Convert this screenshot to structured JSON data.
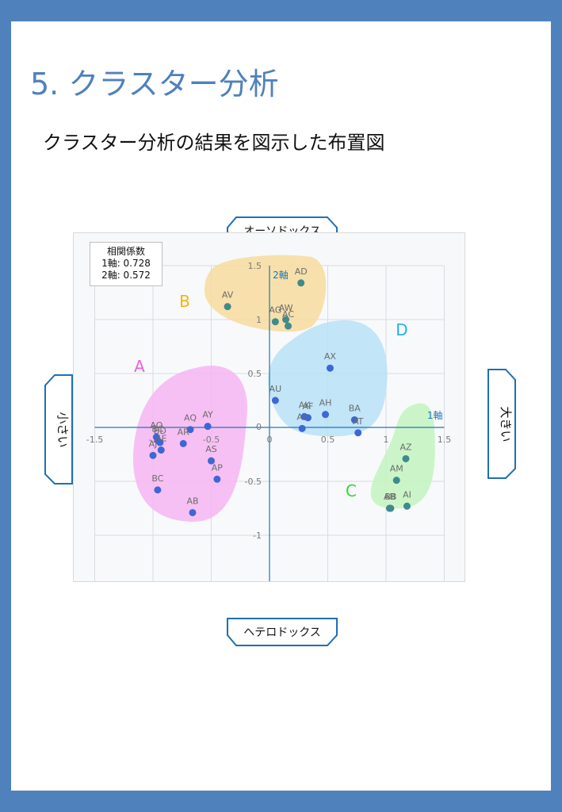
{
  "page": {
    "section_title": "5. クラスター分析",
    "subtitle": "クラスター分析の結果を図示した布置図"
  },
  "axis_end_labels": {
    "top": "オーソドックス",
    "bottom": "ヘテロドックス",
    "left": "小さい",
    "right": "大きい"
  },
  "correlation_box": {
    "title": "相関係数",
    "axis1": "1軸: 0.728",
    "axis2": "2軸: 0.572"
  },
  "colors": {
    "border": "#4f81bd",
    "axis": "#1f77b4",
    "cluster_A": "#f7b6f2",
    "cluster_B": "#f7dc9c",
    "cluster_C": "#c3f5c0",
    "cluster_D": "#b9e2f7",
    "label_A": "#f05ce0",
    "label_B": "#f5b400",
    "label_C": "#3ad43a",
    "label_D": "#1fb2ee",
    "point_blue": "#3e66d6",
    "point_teal": "#3f8a8c"
  },
  "chart_data": {
    "type": "scatter",
    "xlabel": "1軸",
    "ylabel": "2軸",
    "xlim": [
      -1.5,
      1.5
    ],
    "ylim": [
      -1.5,
      1.5
    ],
    "xticks": [
      -1.5,
      -1,
      -0.5,
      0,
      0.5,
      1,
      1.5
    ],
    "yticks": [
      -1.5,
      -1,
      -0.5,
      0,
      0.5,
      1,
      1.5
    ],
    "grid": true,
    "clusters": [
      {
        "name": "A",
        "color": "#f7b6f2",
        "label_color": "#f05ce0"
      },
      {
        "name": "B",
        "color": "#f7dc9c",
        "label_color": "#f5b400"
      },
      {
        "name": "C",
        "color": "#c3f5c0",
        "label_color": "#3ad43a"
      },
      {
        "name": "D",
        "color": "#b9e2f7",
        "label_color": "#1fb2ee"
      }
    ],
    "points": [
      {
        "label": "AD",
        "x": 0.27,
        "y": 1.34,
        "cluster": "B"
      },
      {
        "label": "AV",
        "x": -0.36,
        "y": 1.12,
        "cluster": "B"
      },
      {
        "label": "AG",
        "x": 0.05,
        "y": 0.98,
        "cluster": "B"
      },
      {
        "label": "AW",
        "x": 0.14,
        "y": 1.0,
        "cluster": "B"
      },
      {
        "label": "AC",
        "x": 0.16,
        "y": 0.94,
        "cluster": "B"
      },
      {
        "label": "AX",
        "x": 0.52,
        "y": 0.55,
        "cluster": "D"
      },
      {
        "label": "AU",
        "x": 0.05,
        "y": 0.25,
        "cluster": "D"
      },
      {
        "label": "AH",
        "x": 0.48,
        "y": 0.12,
        "cluster": "D"
      },
      {
        "label": "AK",
        "x": 0.3,
        "y": 0.1,
        "cluster": "D"
      },
      {
        "label": "AF",
        "x": 0.33,
        "y": 0.09,
        "cluster": "D"
      },
      {
        "label": "AL",
        "x": 0.28,
        "y": -0.01,
        "cluster": "D"
      },
      {
        "label": "BA",
        "x": 0.73,
        "y": 0.07,
        "cluster": "D"
      },
      {
        "label": "AT",
        "x": 0.76,
        "y": -0.05,
        "cluster": "D"
      },
      {
        "label": "AZ",
        "x": 1.17,
        "y": -0.29,
        "cluster": "C"
      },
      {
        "label": "AM",
        "x": 1.09,
        "y": -0.49,
        "cluster": "C"
      },
      {
        "label": "AB",
        "x": 1.03,
        "y": -0.75,
        "cluster": "C"
      },
      {
        "label": "BB",
        "x": 1.04,
        "y": -0.75,
        "cluster": "C"
      },
      {
        "label": "AI",
        "x": 1.18,
        "y": -0.73,
        "cluster": "C"
      },
      {
        "label": "AQ",
        "x": -0.68,
        "y": -0.02,
        "cluster": "A"
      },
      {
        "label": "AY",
        "x": -0.53,
        "y": 0.01,
        "cluster": "A"
      },
      {
        "label": "AO",
        "x": -0.97,
        "y": -0.09,
        "cluster": "A"
      },
      {
        "label": "BC",
        "x": -0.96,
        "y": -0.12,
        "cluster": "A"
      },
      {
        "label": "BD",
        "x": -0.94,
        "y": -0.14,
        "cluster": "A"
      },
      {
        "label": "AE",
        "x": -0.93,
        "y": -0.21,
        "cluster": "A"
      },
      {
        "label": "AJ",
        "x": -1.0,
        "y": -0.26,
        "cluster": "A"
      },
      {
        "label": "AR",
        "x": -0.74,
        "y": -0.15,
        "cluster": "A"
      },
      {
        "label": "AS",
        "x": -0.5,
        "y": -0.31,
        "cluster": "A"
      },
      {
        "label": "AP",
        "x": -0.45,
        "y": -0.48,
        "cluster": "A"
      },
      {
        "label": "BC",
        "x": -0.96,
        "y": -0.58,
        "cluster": "A"
      },
      {
        "label": "AB",
        "x": -0.66,
        "y": -0.79,
        "cluster": "A"
      }
    ]
  }
}
